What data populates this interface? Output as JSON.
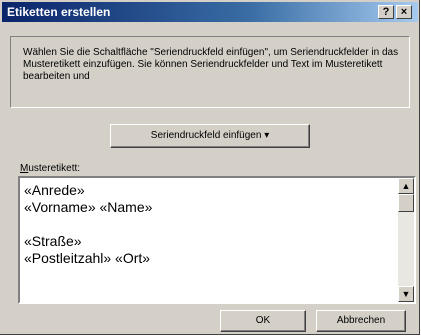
{
  "dialog": {
    "title": "Etiketten erstellen",
    "help_button": "?",
    "close_button": "×",
    "instruction": "Wählen Sie die Schaltfläche \"Seriendruckfeld einfügen\", um Seriendruckfelder in das Musteretikett einzufügen. Sie können Seriendruckfelder und Text im Musteretikett bearbeiten und",
    "insert_field_button": "Seriendruckfeld einfügen ▾",
    "sample_label_accesskey": "M",
    "sample_label_rest": "usteretikett:",
    "sample_lines": [
      "«Anrede»",
      "«Vorname» «Name»",
      "",
      "«Straße»",
      "«Postleitzahl» «Ort»"
    ],
    "ok_button": "OK",
    "cancel_button": "Abbrechen"
  }
}
